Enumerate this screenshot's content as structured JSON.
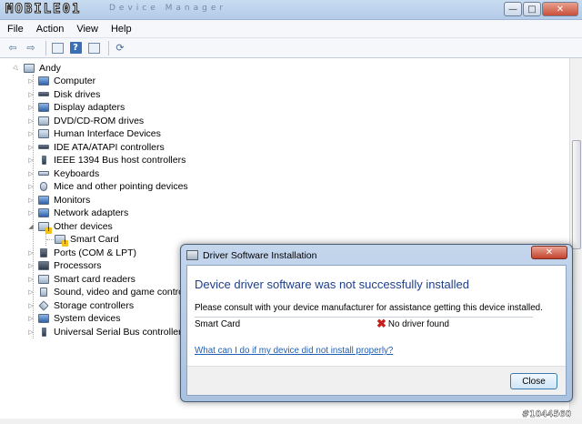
{
  "window": {
    "logo_text": "MOBILE01",
    "title": "Device Manager",
    "min_label": "—",
    "max_label": "□",
    "close_label": "✕"
  },
  "menu": [
    "File",
    "Action",
    "View",
    "Help"
  ],
  "toolbar": {
    "icons": [
      "back-icon",
      "forward-icon",
      "properties-icon",
      "help-icon",
      "view-icon",
      "scan-hardware-icon"
    ],
    "back_glyph": "⇦",
    "forward_glyph": "⇨",
    "help_glyph": "?",
    "scan_glyph": "⟳"
  },
  "tree": {
    "expand_glyph": "▷",
    "collapse_glyph": "◢",
    "root": "Andy",
    "categories": [
      "Computer",
      "Disk drives",
      "Display adapters",
      "DVD/CD-ROM drives",
      "Human Interface Devices",
      "IDE ATA/ATAPI controllers",
      "IEEE 1394 Bus host controllers",
      "Keyboards",
      "Mice and other pointing devices",
      "Monitors",
      "Network adapters",
      "Other devices",
      "Smart Card",
      "Ports (COM & LPT)",
      "Processors",
      "Smart card readers",
      "Sound, video and game controllers",
      "Storage controllers",
      "System devices",
      "Universal Serial Bus controllers"
    ]
  },
  "dialog": {
    "title": "Driver Software Installation",
    "close_label": "✕",
    "heading": "Device driver software was not successfully installed",
    "message": "Please consult with your device manufacturer for assistance getting this device installed.",
    "device_name": "Smart Card",
    "status_glyph": "✖",
    "status": "No driver found",
    "help_link": "What can I do if my device did not install properly?",
    "close_button": "Close"
  },
  "watermark": {
    "id": "#1044560"
  },
  "colors": {
    "heading": "#1e3f8a",
    "link": "#1f5fb3",
    "error": "#c8201c",
    "warning": "#f3c21a"
  }
}
